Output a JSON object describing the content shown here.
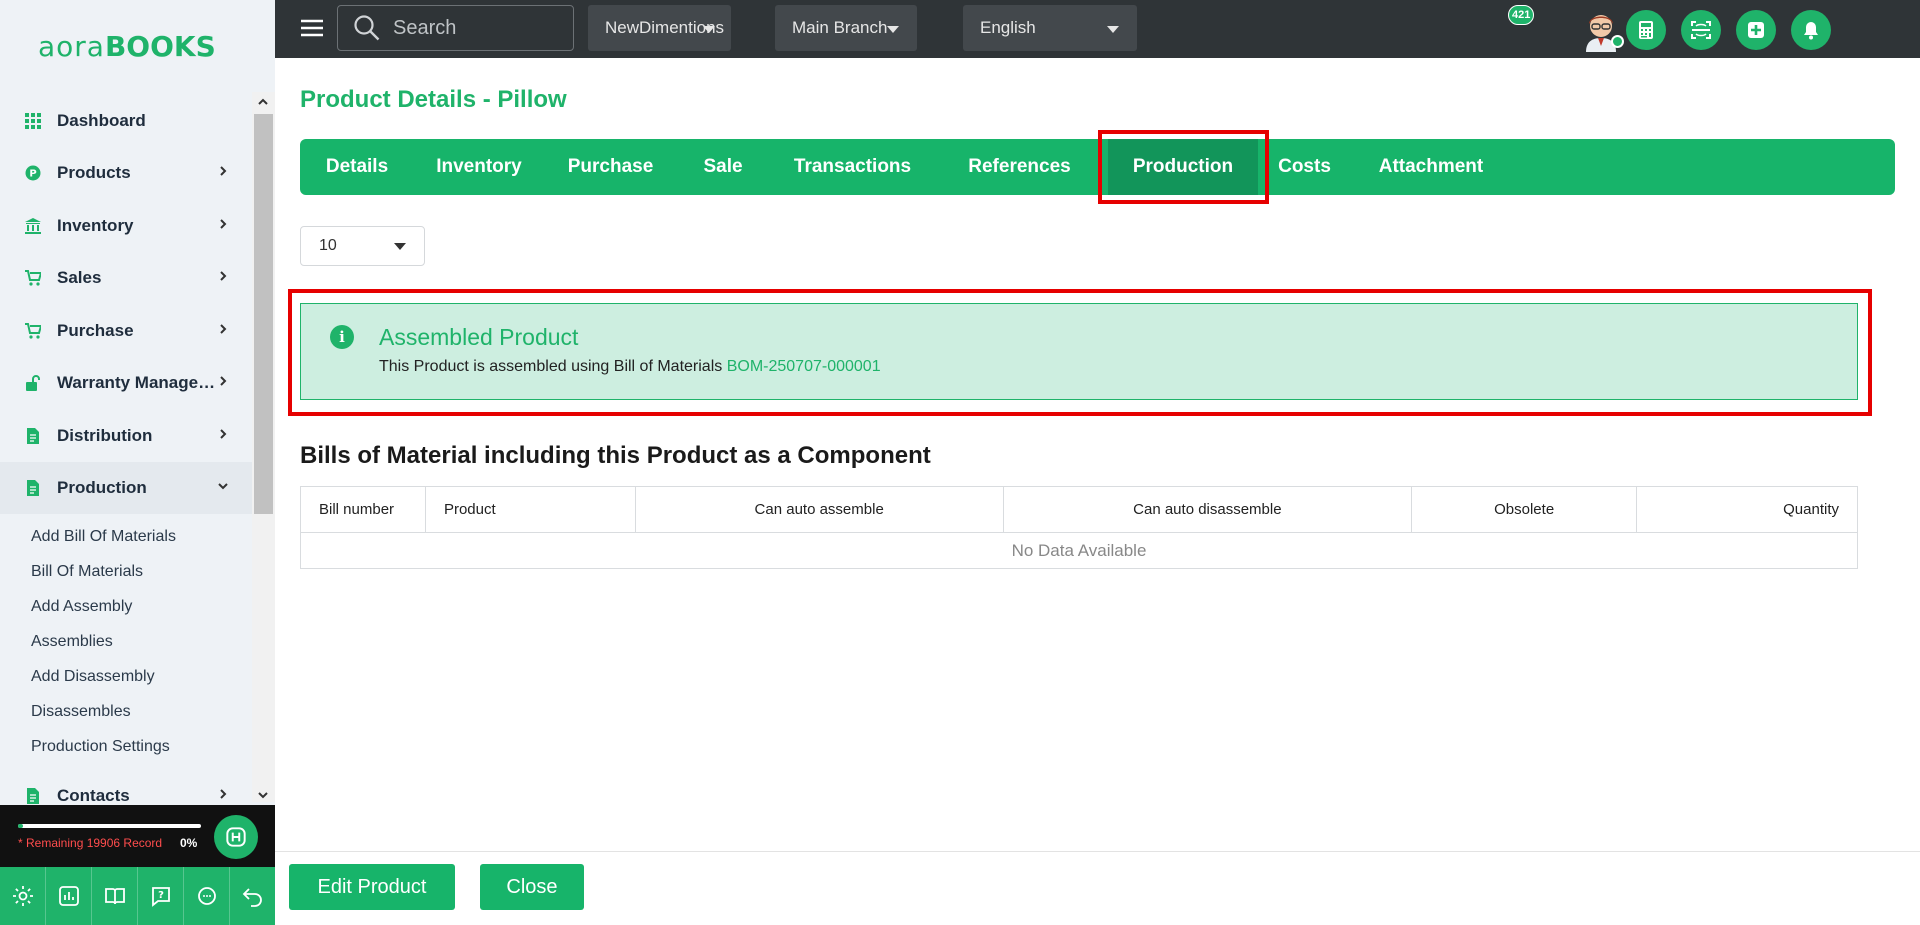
{
  "logo": {
    "part1": "aora",
    "part2": "BOOKS"
  },
  "sidebar": {
    "items": [
      {
        "label": "Dashboard",
        "icon": "grid-icon"
      },
      {
        "label": "Products",
        "icon": "product-icon"
      },
      {
        "label": "Inventory",
        "icon": "bank-icon"
      },
      {
        "label": "Sales",
        "icon": "cart-icon"
      },
      {
        "label": "Purchase",
        "icon": "cart-icon"
      },
      {
        "label": "Warranty Management",
        "icon": "unlock-icon"
      },
      {
        "label": "Distribution",
        "icon": "document-icon"
      },
      {
        "label": "Production",
        "icon": "document-icon"
      },
      {
        "label": "Contacts",
        "icon": "document-icon"
      }
    ],
    "production_sub": [
      "Add Bill Of Materials",
      "Bill Of Materials",
      "Add Assembly",
      "Assemblies",
      "Add Disassembly",
      "Disassembles",
      "Production Settings"
    ],
    "record_text": "* Remaining 19906 Record",
    "record_percent": "0%",
    "record_progress": 0.03
  },
  "topbar": {
    "search_placeholder": "Search",
    "company": "NewDimentions",
    "branch": "Main Branch",
    "language": "English",
    "notification_count": "421"
  },
  "page": {
    "title": "Product Details - Pillow",
    "tabs": [
      "Details",
      "Inventory",
      "Purchase",
      "Sale",
      "Transactions",
      "References",
      "Production",
      "Costs",
      "Attachment"
    ],
    "active_tab": "Production",
    "page_size": "10"
  },
  "alert": {
    "title": "Assembled Product",
    "text": "This Product is assembled using Bill of Materials",
    "link": "BOM-250707-000001"
  },
  "bom_section": {
    "title": "Bills of Material including this Product as a Component",
    "columns": [
      "Bill number",
      "Product",
      "Can auto assemble",
      "Can auto disassemble",
      "Obsolete",
      "Quantity"
    ],
    "empty_text": "No Data Available"
  },
  "footer": {
    "edit_label": "Edit Product",
    "close_label": "Close"
  },
  "colors": {
    "accent": "#1fb36a",
    "highlight": "#e60000",
    "topbar": "#2f3437"
  }
}
